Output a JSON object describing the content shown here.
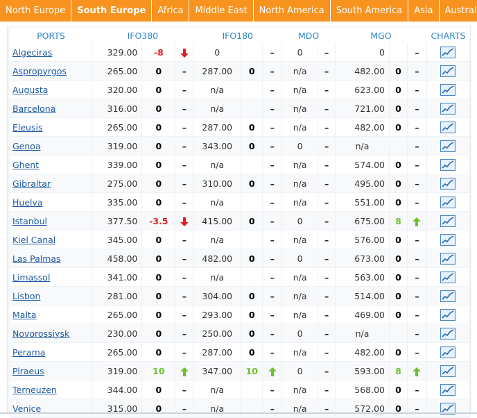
{
  "tabs": [
    "North Europe",
    "South Europe",
    "Africa",
    "Middle East",
    "North America",
    "South America",
    "Asia",
    "Australia"
  ],
  "active_tab": 1,
  "headers": {
    "ports": "PORTS",
    "ifo380": "IFO380",
    "ifo180": "IFO180",
    "mdo": "MDO",
    "mgo": "MGO",
    "charts": "CHARTS"
  },
  "colors": {
    "tab_bg": "#f7931e",
    "header_text": "#2f86c6",
    "down": "#e02020",
    "up": "#6fbf2f"
  },
  "rows": [
    {
      "port": "Algeciras",
      "ifo380": "329.00",
      "ifo380_chg": "-8",
      "ifo380_dir": "down",
      "ifo180": "0",
      "ifo180_chg": "",
      "ifo180_dir": "flat",
      "mdo": "0",
      "mdo_dir": "flat",
      "mgo": "0",
      "mgo_chg": "",
      "mgo_dir": "flat"
    },
    {
      "port": "Aspropyrgos",
      "ifo380": "265.00",
      "ifo380_chg": "0",
      "ifo380_dir": "flat",
      "ifo180": "287.00",
      "ifo180_chg": "0",
      "ifo180_dir": "flat",
      "mdo": "n/a",
      "mdo_dir": "flat",
      "mgo": "482.00",
      "mgo_chg": "0",
      "mgo_dir": "flat"
    },
    {
      "port": "Augusta",
      "ifo380": "320.00",
      "ifo380_chg": "0",
      "ifo380_dir": "flat",
      "ifo180": "n/a",
      "ifo180_chg": "",
      "ifo180_dir": "flat",
      "mdo": "n/a",
      "mdo_dir": "flat",
      "mgo": "623.00",
      "mgo_chg": "0",
      "mgo_dir": "flat"
    },
    {
      "port": "Barcelona",
      "ifo380": "316.00",
      "ifo380_chg": "0",
      "ifo380_dir": "flat",
      "ifo180": "n/a",
      "ifo180_chg": "",
      "ifo180_dir": "flat",
      "mdo": "n/a",
      "mdo_dir": "flat",
      "mgo": "721.00",
      "mgo_chg": "0",
      "mgo_dir": "flat"
    },
    {
      "port": "Eleusis",
      "ifo380": "265.00",
      "ifo380_chg": "0",
      "ifo380_dir": "flat",
      "ifo180": "287.00",
      "ifo180_chg": "0",
      "ifo180_dir": "flat",
      "mdo": "n/a",
      "mdo_dir": "flat",
      "mgo": "482.00",
      "mgo_chg": "0",
      "mgo_dir": "flat"
    },
    {
      "port": "Genoa",
      "ifo380": "319.00",
      "ifo380_chg": "0",
      "ifo380_dir": "flat",
      "ifo180": "343.00",
      "ifo180_chg": "0",
      "ifo180_dir": "flat",
      "mdo": "0",
      "mdo_dir": "flat",
      "mgo": "n/a",
      "mgo_chg": "",
      "mgo_dir": "flat"
    },
    {
      "port": "Ghent",
      "ifo380": "339.00",
      "ifo380_chg": "0",
      "ifo380_dir": "flat",
      "ifo180": "n/a",
      "ifo180_chg": "",
      "ifo180_dir": "flat",
      "mdo": "n/a",
      "mdo_dir": "flat",
      "mgo": "574.00",
      "mgo_chg": "0",
      "mgo_dir": "flat"
    },
    {
      "port": "Gibraltar",
      "ifo380": "275.00",
      "ifo380_chg": "0",
      "ifo380_dir": "flat",
      "ifo180": "310.00",
      "ifo180_chg": "0",
      "ifo180_dir": "flat",
      "mdo": "n/a",
      "mdo_dir": "flat",
      "mgo": "495.00",
      "mgo_chg": "0",
      "mgo_dir": "flat"
    },
    {
      "port": "Huelva",
      "ifo380": "335.00",
      "ifo380_chg": "0",
      "ifo380_dir": "flat",
      "ifo180": "n/a",
      "ifo180_chg": "",
      "ifo180_dir": "flat",
      "mdo": "n/a",
      "mdo_dir": "flat",
      "mgo": "551.00",
      "mgo_chg": "0",
      "mgo_dir": "flat"
    },
    {
      "port": "Istanbul",
      "ifo380": "377.50",
      "ifo380_chg": "-3.5",
      "ifo380_dir": "down",
      "ifo180": "415.00",
      "ifo180_chg": "0",
      "ifo180_dir": "flat",
      "mdo": "0",
      "mdo_dir": "flat",
      "mgo": "675.00",
      "mgo_chg": "8",
      "mgo_dir": "up"
    },
    {
      "port": "Kiel Canal",
      "ifo380": "345.00",
      "ifo380_chg": "0",
      "ifo380_dir": "flat",
      "ifo180": "n/a",
      "ifo180_chg": "",
      "ifo180_dir": "flat",
      "mdo": "n/a",
      "mdo_dir": "flat",
      "mgo": "576.00",
      "mgo_chg": "0",
      "mgo_dir": "flat"
    },
    {
      "port": "Las Palmas",
      "ifo380": "458.00",
      "ifo380_chg": "0",
      "ifo380_dir": "flat",
      "ifo180": "482.00",
      "ifo180_chg": "0",
      "ifo180_dir": "flat",
      "mdo": "0",
      "mdo_dir": "flat",
      "mgo": "673.00",
      "mgo_chg": "0",
      "mgo_dir": "flat"
    },
    {
      "port": "Limassol",
      "ifo380": "341.00",
      "ifo380_chg": "0",
      "ifo380_dir": "flat",
      "ifo180": "n/a",
      "ifo180_chg": "",
      "ifo180_dir": "flat",
      "mdo": "n/a",
      "mdo_dir": "flat",
      "mgo": "563.00",
      "mgo_chg": "0",
      "mgo_dir": "flat"
    },
    {
      "port": "Lisbon",
      "ifo380": "281.00",
      "ifo380_chg": "0",
      "ifo380_dir": "flat",
      "ifo180": "304.00",
      "ifo180_chg": "0",
      "ifo180_dir": "flat",
      "mdo": "n/a",
      "mdo_dir": "flat",
      "mgo": "514.00",
      "mgo_chg": "0",
      "mgo_dir": "flat"
    },
    {
      "port": "Malta",
      "ifo380": "265.00",
      "ifo380_chg": "0",
      "ifo380_dir": "flat",
      "ifo180": "293.00",
      "ifo180_chg": "0",
      "ifo180_dir": "flat",
      "mdo": "n/a",
      "mdo_dir": "flat",
      "mgo": "469.00",
      "mgo_chg": "0",
      "mgo_dir": "flat"
    },
    {
      "port": "Novorossiysk",
      "ifo380": "230.00",
      "ifo380_chg": "0",
      "ifo380_dir": "flat",
      "ifo180": "250.00",
      "ifo180_chg": "0",
      "ifo180_dir": "flat",
      "mdo": "0",
      "mdo_dir": "flat",
      "mgo": "n/a",
      "mgo_chg": "",
      "mgo_dir": "flat"
    },
    {
      "port": "Perama",
      "ifo380": "265.00",
      "ifo380_chg": "0",
      "ifo380_dir": "flat",
      "ifo180": "287.00",
      "ifo180_chg": "0",
      "ifo180_dir": "flat",
      "mdo": "n/a",
      "mdo_dir": "flat",
      "mgo": "482.00",
      "mgo_chg": "0",
      "mgo_dir": "flat"
    },
    {
      "port": "Piraeus",
      "ifo380": "319.00",
      "ifo380_chg": "10",
      "ifo380_dir": "up",
      "ifo180": "347.00",
      "ifo180_chg": "10",
      "ifo180_dir": "up",
      "mdo": "0",
      "mdo_dir": "flat",
      "mgo": "593.00",
      "mgo_chg": "8",
      "mgo_dir": "up"
    },
    {
      "port": "Terneuzen",
      "ifo380": "344.00",
      "ifo380_chg": "0",
      "ifo380_dir": "flat",
      "ifo180": "n/a",
      "ifo180_chg": "",
      "ifo180_dir": "flat",
      "mdo": "n/a",
      "mdo_dir": "flat",
      "mgo": "568.00",
      "mgo_chg": "0",
      "mgo_dir": "flat"
    },
    {
      "port": "Venice",
      "ifo380": "315.00",
      "ifo380_chg": "0",
      "ifo380_dir": "flat",
      "ifo180": "n/a",
      "ifo180_chg": "",
      "ifo180_dir": "flat",
      "mdo": "n/a",
      "mdo_dir": "flat",
      "mgo": "572.00",
      "mgo_chg": "0",
      "mgo_dir": "flat"
    }
  ]
}
